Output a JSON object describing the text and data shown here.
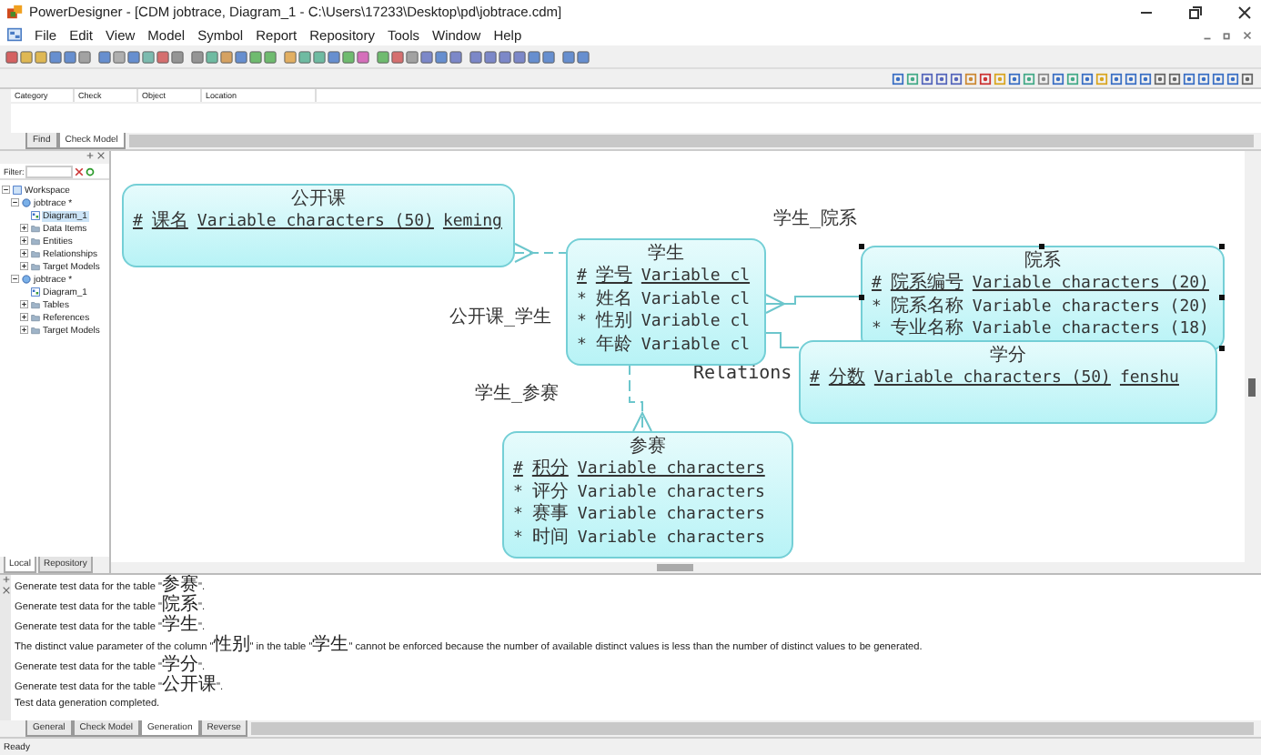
{
  "window": {
    "title": "PowerDesigner - [CDM jobtrace, Diagram_1 - C:\\Users\\17233\\Desktop\\pd\\jobtrace.cdm]"
  },
  "menu": [
    "File",
    "Edit",
    "View",
    "Model",
    "Symbol",
    "Report",
    "Repository",
    "Tools",
    "Window",
    "Help"
  ],
  "results_panel": {
    "columns": [
      "Category",
      "Check",
      "Object",
      "Location"
    ],
    "tabs": [
      {
        "label": "Find",
        "selected": false
      },
      {
        "label": "Check Model",
        "selected": true
      }
    ]
  },
  "browser": {
    "filter_label": "Filter:",
    "tree": [
      {
        "label": "Workspace",
        "kind": "workspace",
        "selected": false,
        "expanded": true,
        "children": [
          {
            "label": "jobtrace *",
            "kind": "model",
            "selected": false,
            "expanded": true,
            "children": [
              {
                "label": "Diagram_1",
                "kind": "diagram",
                "selected": true
              },
              {
                "label": "Data Items",
                "kind": "folder",
                "selected": false,
                "expanded": false
              },
              {
                "label": "Entities",
                "kind": "folder",
                "selected": false,
                "expanded": false
              },
              {
                "label": "Relationships",
                "kind": "folder",
                "selected": false,
                "expanded": false
              },
              {
                "label": "Target Models",
                "kind": "folder",
                "selected": false,
                "expanded": false
              }
            ]
          },
          {
            "label": "jobtrace *",
            "kind": "model",
            "selected": false,
            "expanded": true,
            "children": [
              {
                "label": "Diagram_1",
                "kind": "diagram",
                "selected": false
              },
              {
                "label": "Tables",
                "kind": "folder",
                "selected": false,
                "expanded": false
              },
              {
                "label": "References",
                "kind": "folder",
                "selected": false,
                "expanded": false
              },
              {
                "label": "Target Models",
                "kind": "folder",
                "selected": false,
                "expanded": false
              }
            ]
          }
        ]
      }
    ],
    "tabs": [
      {
        "label": "Local",
        "selected": true
      },
      {
        "label": "Repository",
        "selected": false
      }
    ]
  },
  "diagram": {
    "entities": [
      {
        "name": "公开课",
        "selected": false,
        "attributes": [
          {
            "marker": "#",
            "name": "课名",
            "type": "Variable characters (50)",
            "code": "keming",
            "identifier": true
          }
        ]
      },
      {
        "name": "学生",
        "selected": false,
        "attributes": [
          {
            "marker": "#",
            "name": "学号",
            "type": "Variable cl",
            "identifier": true
          },
          {
            "marker": "*",
            "name": "姓名",
            "type": "Variable cl",
            "identifier": false
          },
          {
            "marker": "*",
            "name": "性别",
            "type": "Variable cl",
            "identifier": false
          },
          {
            "marker": "*",
            "name": "年龄",
            "type": "Variable cl",
            "identifier": false
          }
        ]
      },
      {
        "name": "院系",
        "selected": true,
        "attributes": [
          {
            "marker": "#",
            "name": "院系编号",
            "type": "Variable characters (20)",
            "identifier": true
          },
          {
            "marker": "*",
            "name": "院系名称",
            "type": "Variable characters (20)",
            "identifier": false
          },
          {
            "marker": "*",
            "name": "专业名称",
            "type": "Variable characters (18)",
            "identifier": false
          }
        ]
      },
      {
        "name": "学分",
        "selected": false,
        "attributes": [
          {
            "marker": "#",
            "name": "分数",
            "type": "Variable characters (50)",
            "code": "fenshu",
            "identifier": true
          }
        ]
      },
      {
        "name": "参赛",
        "selected": false,
        "attributes": [
          {
            "marker": "#",
            "name": "积分",
            "type": "Variable characters",
            "identifier": true
          },
          {
            "marker": "*",
            "name": "评分",
            "type": "Variable characters",
            "identifier": false
          },
          {
            "marker": "*",
            "name": "赛事",
            "type": "Variable characters",
            "identifier": false
          },
          {
            "marker": "*",
            "name": "时间",
            "type": "Variable characters",
            "identifier": false
          }
        ]
      }
    ],
    "relationships": [
      {
        "label": "公开课_学生"
      },
      {
        "label": "学生_院系"
      },
      {
        "label": "Relations"
      },
      {
        "label": "学生_参赛"
      }
    ]
  },
  "output": {
    "lines": [
      "Generate test data for the table \"参赛\".",
      "Generate test data for the table \"院系\".",
      "Generate test data for the table \"学生\".",
      "The distinct value parameter of the column \"性别\" in the table \"学生\" cannot be enforced because the number of available distinct values is less than the number of distinct values to be generated.",
      "Generate test data for the table \"学分\".",
      "Generate test data for the table \"公开课\".",
      "Test data generation completed."
    ],
    "tabs": [
      {
        "label": "General",
        "selected": false
      },
      {
        "label": "Check Model",
        "selected": false
      },
      {
        "label": "Generation",
        "selected": true
      },
      {
        "label": "Reverse",
        "selected": false
      }
    ]
  },
  "status_bar": "Ready"
}
